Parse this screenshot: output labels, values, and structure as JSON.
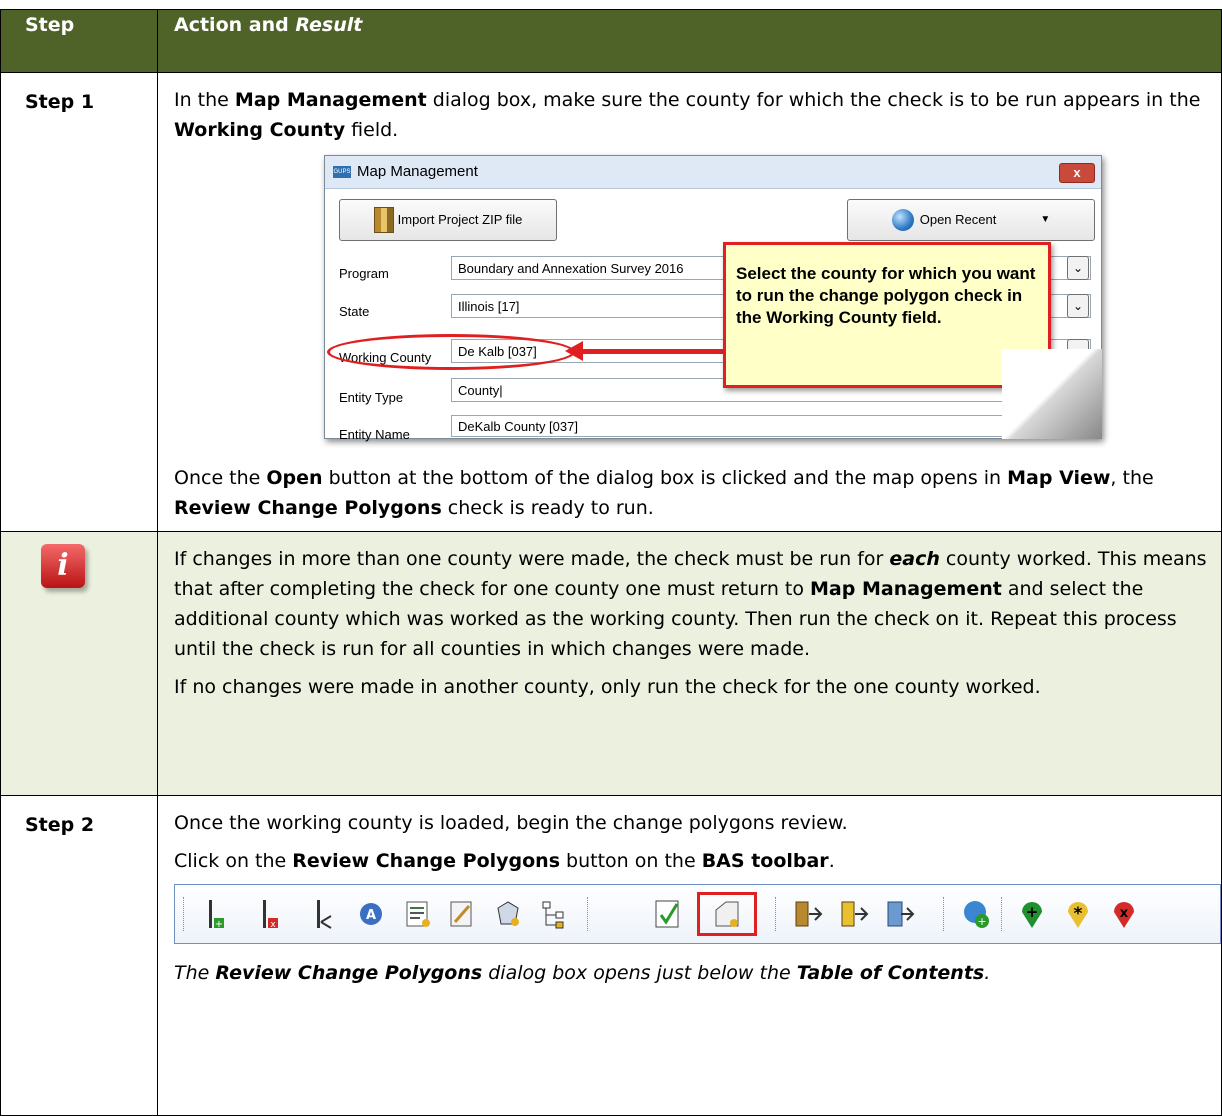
{
  "header": {
    "step_label": "Step",
    "action_prefix": "Action and ",
    "action_result": "Result"
  },
  "step1": {
    "label": "Step 1",
    "p1": [
      "In the ",
      "Map Management",
      " dialog box, make sure the county for which the check is to be run appears in the ",
      "Working County",
      " field."
    ],
    "dialog": {
      "title": "Map Management",
      "close": "x",
      "import_btn": "Import Project ZIP file",
      "open_recent_btn": "Open Recent",
      "fields": [
        {
          "label": "Program",
          "value": "Boundary and Annexation Survey 2016"
        },
        {
          "label": "State",
          "value": "Illinois [17]"
        },
        {
          "label": "Working County",
          "value": "De Kalb [037]"
        },
        {
          "label": "Entity Type",
          "value": "County|"
        },
        {
          "label": "Entity Name",
          "value": "DeKalb County [037]"
        }
      ],
      "callout": "Select the county for which you want to run the change polygon check in the Working County field."
    },
    "p2": [
      "Once the ",
      "Open",
      " button at the bottom of the dialog box is clicked and the map opens in ",
      "Map View",
      ", the ",
      "Review Change Polygons",
      " check is ready to run."
    ]
  },
  "note": {
    "p1": [
      "If changes in more than one county were made, the check must be run for ",
      "each",
      " county worked. This means that after completing the check for one county one must return to ",
      "Map Management",
      " and select the additional county which was worked as the working county. Then run the check on it. Repeat this process until the check is run for all counties in which changes were made."
    ],
    "p2": "If no changes were made in another county, only run the check for the one county worked.",
    "icon": "i"
  },
  "step2": {
    "label": "Step 2",
    "p1": "Once the working county is loaded, begin the change polygons review.",
    "p2": [
      "Click on the ",
      "Review Change Polygons",
      " button on the ",
      "BAS toolbar",
      "."
    ],
    "toolbar_icons": [
      "add-line-icon",
      "delete-line-icon",
      "split-line-icon",
      "attribute-icon",
      "report-icon",
      "edit-table-icon",
      "polygon-icon",
      "tree-icon",
      "validate-check-icon",
      "review-change-polygons-icon",
      "export-zip-icon",
      "import-zip-icon",
      "export-map-icon",
      "add-globe-icon",
      "add-point-icon",
      "asterisk-point-icon",
      "delete-point-icon"
    ],
    "p3": [
      "The ",
      "Review Change Polygons",
      " dialog box opens just below the ",
      "Table of Contents",
      "."
    ]
  },
  "colors": {
    "header_bg": "#4f6228",
    "note_bg": "#ebf1de",
    "highlight": "#e02020"
  }
}
